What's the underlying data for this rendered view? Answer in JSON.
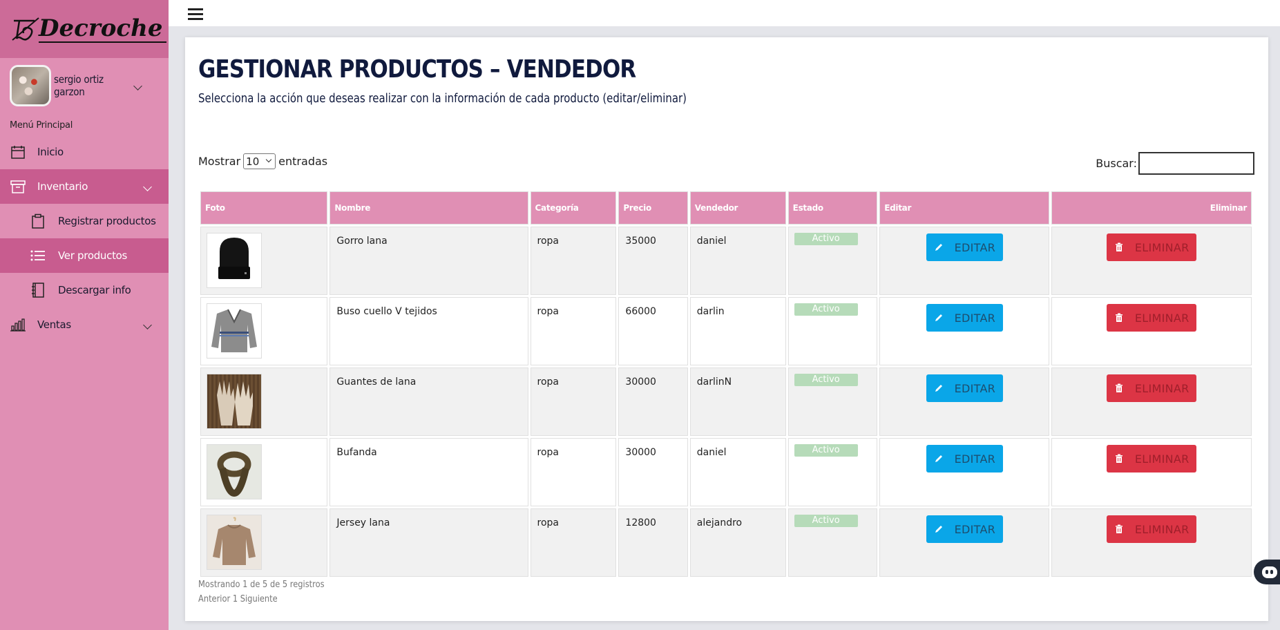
{
  "brand": {
    "name": "Decroche"
  },
  "user": {
    "name": "sergio ortiz garzon"
  },
  "sidebar": {
    "menu_label": "Menú Principal",
    "items": [
      {
        "label": "Inicio",
        "icon": "calendar-icon"
      },
      {
        "label": "Inventario",
        "icon": "archive-box-icon"
      },
      {
        "label": "Ventas",
        "icon": "bar-chart-icon"
      }
    ],
    "sub_items": [
      {
        "label": "Registrar productos",
        "icon": "clipboard-icon"
      },
      {
        "label": "Ver productos",
        "icon": "list-icon"
      },
      {
        "label": "Descargar info",
        "icon": "journal-icon"
      }
    ]
  },
  "page": {
    "title": "GESTIONAR PRODUCTOS – VENDEDOR",
    "subtitle": "Selecciona la acción que deseas realizar con la información de cada producto (editar/eliminar)"
  },
  "table_controls": {
    "show_prefix": "Mostrar",
    "show_value": "10",
    "show_suffix": "entradas",
    "search_label": "Buscar:",
    "search_value": ""
  },
  "table": {
    "headers": [
      "Foto",
      "Nombre",
      "Categoría",
      "Precio",
      "Vendedor",
      "Estado",
      "Editar",
      "Eliminar"
    ],
    "rows": [
      {
        "nombre": "Gorro lana",
        "categoria": "ropa",
        "precio": "35000",
        "vendedor": "daniel",
        "estado": "Activo"
      },
      {
        "nombre": "Buso cuello V tejidos",
        "categoria": "ropa",
        "precio": "66000",
        "vendedor": "darlin",
        "estado": "Activo"
      },
      {
        "nombre": "Guantes de lana",
        "categoria": "ropa",
        "precio": "30000",
        "vendedor": "darlinN",
        "estado": "Activo"
      },
      {
        "nombre": "Bufanda",
        "categoria": "ropa",
        "precio": "30000",
        "vendedor": "daniel",
        "estado": "Activo"
      },
      {
        "nombre": "Jersey lana",
        "categoria": "ropa",
        "precio": "12800",
        "vendedor": "alejandro",
        "estado": "Activo"
      }
    ],
    "edit_label": "EDITAR",
    "delete_label": "ELIMINAR"
  },
  "footer": {
    "info": "Mostrando 1 de 5 de 5 registros",
    "pagination": "Anterior 1 Siguiente"
  },
  "colors": {
    "sidebar": "#e08fb4",
    "sidebar_active": "#c85c8f",
    "edit": "#0aa6e8",
    "delete": "#dc3545",
    "badge": "#b6dbb9"
  }
}
